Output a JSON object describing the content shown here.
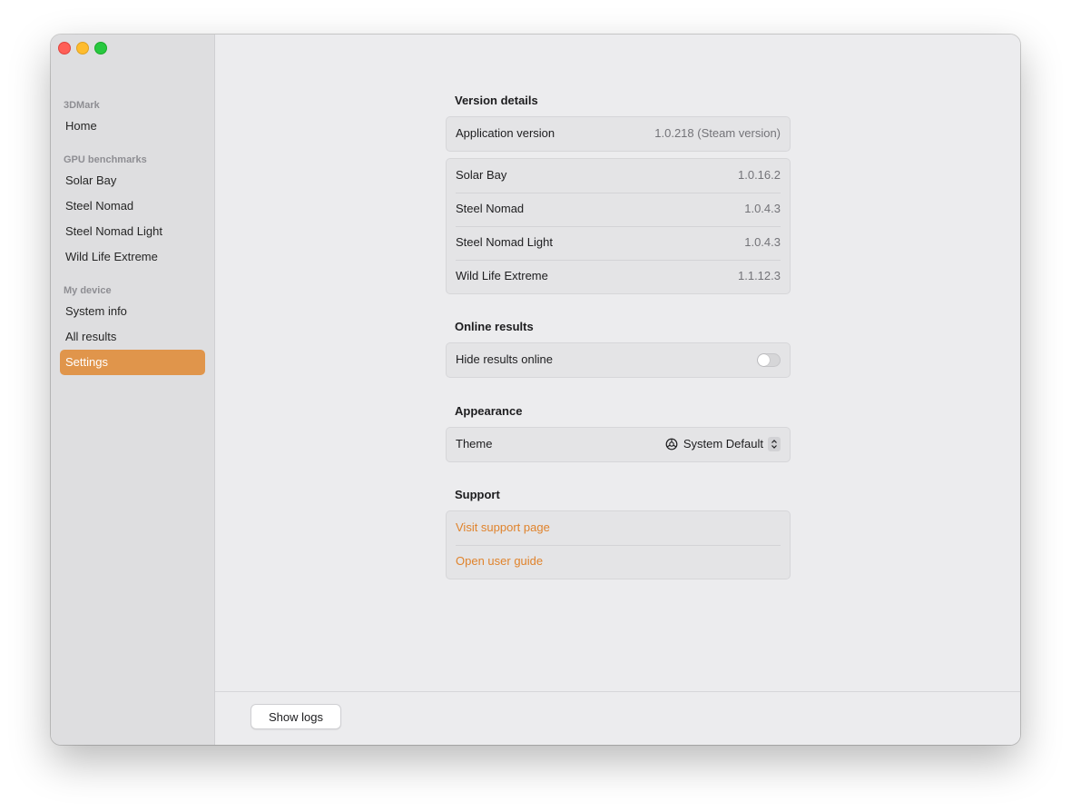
{
  "window": {
    "traffic_lights": [
      "close",
      "minimize",
      "maximize"
    ]
  },
  "sidebar": {
    "sections": [
      {
        "title": "3DMark",
        "items": [
          "Home"
        ]
      },
      {
        "title": "GPU benchmarks",
        "items": [
          "Solar Bay",
          "Steel Nomad",
          "Steel Nomad Light",
          "Wild Life Extreme"
        ]
      },
      {
        "title": "My device",
        "items": [
          "System info",
          "All results",
          "Settings"
        ]
      }
    ],
    "active_item": "Settings",
    "accent_color": "#e0954b"
  },
  "version_details": {
    "title": "Version details",
    "app_label": "Application version",
    "app_value": "1.0.218 (Steam version)",
    "benchmarks": [
      {
        "name": "Solar Bay",
        "version": "1.0.16.2"
      },
      {
        "name": "Steel Nomad",
        "version": "1.0.4.3"
      },
      {
        "name": "Steel Nomad Light",
        "version": "1.0.4.3"
      },
      {
        "name": "Wild Life Extreme",
        "version": "1.1.12.3"
      }
    ]
  },
  "online_results": {
    "title": "Online results",
    "hide_label": "Hide results online",
    "hide_enabled": false
  },
  "appearance": {
    "title": "Appearance",
    "theme_label": "Theme",
    "theme_value": "System Default",
    "theme_icon": "system-theme-icon"
  },
  "support": {
    "title": "Support",
    "visit_link": "Visit support page",
    "guide_link": "Open user guide",
    "link_color": "#e0832c"
  },
  "footer": {
    "show_logs_label": "Show logs"
  }
}
